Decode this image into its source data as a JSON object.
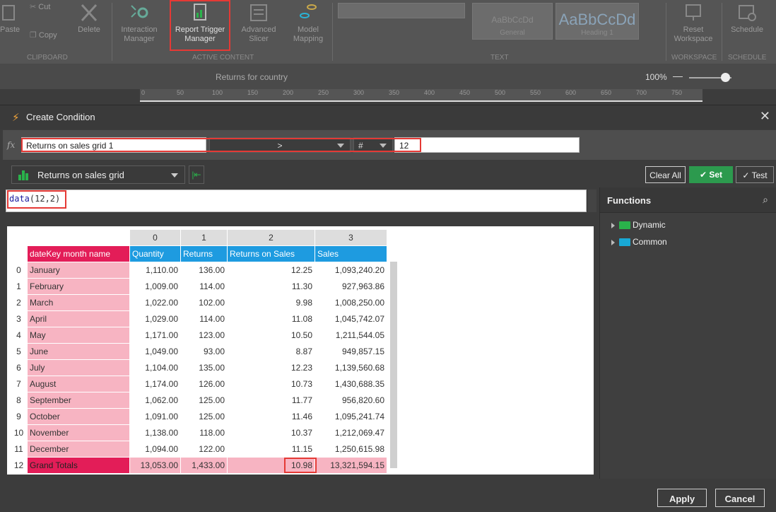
{
  "ribbon": {
    "tools": [
      {
        "name": "paste",
        "label": "Paste"
      },
      {
        "name": "cut",
        "label": "Cut"
      },
      {
        "name": "copy",
        "label": "Copy"
      },
      {
        "name": "delete",
        "label": "Delete"
      },
      {
        "name": "interaction-manager",
        "label": "Interaction Manager"
      },
      {
        "name": "report-trigger-manager",
        "label": "Report Trigger Manager"
      },
      {
        "name": "advanced-slicer",
        "label": "Advanced Slicer"
      },
      {
        "name": "model-mapping",
        "label": "Model Mapping"
      },
      {
        "name": "reset-workspace",
        "label": "Reset Workspace"
      },
      {
        "name": "schedule",
        "label": "Schedule"
      }
    ],
    "groups": {
      "clipboard": "CLIPBOARD",
      "active_content": "ACTIVE CONTENT",
      "text": "TEXT",
      "workspace": "WORKSPACE",
      "schedule": "SCHEDULE"
    },
    "styles": {
      "normal_sample": "AaBbCcDd",
      "normal_label": "General",
      "heading_sample": "AaBbCcDd",
      "heading_label": "Heading 1"
    }
  },
  "subbar": {
    "title": "Returns for country",
    "zoom": "100%",
    "zoom_minus": "—"
  },
  "ruler_ticks": [
    "0",
    "50",
    "100",
    "150",
    "200",
    "250",
    "300",
    "350",
    "400",
    "450",
    "500",
    "550",
    "600",
    "650",
    "700",
    "750"
  ],
  "dialog": {
    "title": "Create Condition",
    "close": "✕",
    "condition": {
      "fx": "fx",
      "left_operand": "Returns on sales grid 1",
      "operator": ">",
      "value_type": "#",
      "value": "12"
    },
    "grid_selector": "Returns on sales grid",
    "buttons": {
      "clear_all": "Clear All",
      "set": "Set",
      "test": "Test",
      "apply": "Apply",
      "cancel": "Cancel"
    },
    "expression": {
      "fn": "data",
      "args": "(12,2)"
    },
    "functions": {
      "title": "Functions",
      "items": [
        "Dynamic",
        "Common"
      ]
    },
    "colors": {
      "dimension": "#e31d58",
      "measure": "#1e9be0",
      "dim_cell": "#f7b4c2",
      "set_button": "#2c9a4e",
      "dynamic_folder": "#2ab34b",
      "common_folder": "#19a9d6"
    }
  },
  "grid": {
    "col_indices": [
      "0",
      "1",
      "2",
      "3"
    ],
    "dim_header": "dateKey month name",
    "measure_headers": [
      "Quantity",
      "Returns",
      "Returns on Sales",
      "Sales"
    ],
    "rows": [
      {
        "idx": "0",
        "month": "January",
        "vals": [
          "1,110.00",
          "136.00",
          "12.25",
          "1,093,240.20"
        ]
      },
      {
        "idx": "1",
        "month": "February",
        "vals": [
          "1,009.00",
          "114.00",
          "11.30",
          "927,963.86"
        ]
      },
      {
        "idx": "2",
        "month": "March",
        "vals": [
          "1,022.00",
          "102.00",
          "9.98",
          "1,008,250.00"
        ]
      },
      {
        "idx": "3",
        "month": "April",
        "vals": [
          "1,029.00",
          "114.00",
          "11.08",
          "1,045,742.07"
        ]
      },
      {
        "idx": "4",
        "month": "May",
        "vals": [
          "1,171.00",
          "123.00",
          "10.50",
          "1,211,544.05"
        ]
      },
      {
        "idx": "5",
        "month": "June",
        "vals": [
          "1,049.00",
          "93.00",
          "8.87",
          "949,857.15"
        ]
      },
      {
        "idx": "6",
        "month": "July",
        "vals": [
          "1,104.00",
          "135.00",
          "12.23",
          "1,139,560.68"
        ]
      },
      {
        "idx": "7",
        "month": "August",
        "vals": [
          "1,174.00",
          "126.00",
          "10.73",
          "1,430,688.35"
        ]
      },
      {
        "idx": "8",
        "month": "September",
        "vals": [
          "1,062.00",
          "125.00",
          "11.77",
          "956,820.60"
        ]
      },
      {
        "idx": "9",
        "month": "October",
        "vals": [
          "1,091.00",
          "125.00",
          "11.46",
          "1,095,241.74"
        ]
      },
      {
        "idx": "10",
        "month": "November",
        "vals": [
          "1,138.00",
          "118.00",
          "10.37",
          "1,212,069.47"
        ]
      },
      {
        "idx": "11",
        "month": "December",
        "vals": [
          "1,094.00",
          "122.00",
          "11.15",
          "1,250,615.98"
        ]
      },
      {
        "idx": "12",
        "month": "Grand Totals",
        "vals": [
          "13,053.00",
          "1,433.00",
          "10.98",
          "13,321,594.15"
        ],
        "total": true
      }
    ]
  }
}
